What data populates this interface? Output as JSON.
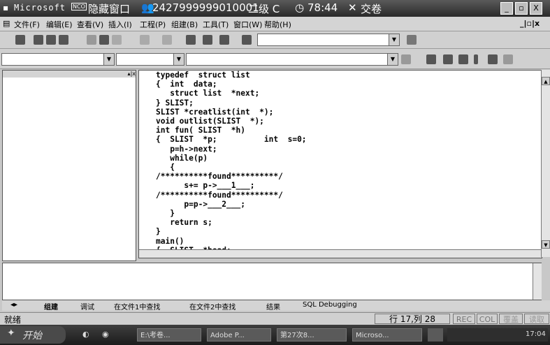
{
  "titlebar": {
    "app_name": "Microsoft",
    "badge": "NCO",
    "hide_window": "隐藏窗口",
    "exam_id": "2427999999010001",
    "level": "二级 C",
    "timer": "78:44",
    "submit": "交卷"
  },
  "window_buttons": {
    "minimize": "_",
    "restore": "▫",
    "close": "X"
  },
  "menu": {
    "items": [
      "文件(F)",
      "编辑(E)",
      "查看(V)",
      "插入(I)",
      "工程(P)",
      "组建(B)",
      "工具(T)",
      "窗口(W)",
      "帮助(H)"
    ],
    "child_controls": "_|▫|x"
  },
  "left_pane": {
    "header_controls": "▴|x"
  },
  "code_lines": [
    "typedef  struct list",
    "{  int  data;",
    "   struct list  *next;",
    "} SLIST;",
    "SLIST *creatlist(int  *);",
    "void outlist(SLIST  *);",
    "int fun( SLIST  *h)",
    "{  SLIST  *p;          int  s=0;",
    "   p=h->next;",
    "   while(p)",
    "   {",
    "/**********found**********/",
    "      s+= p->___1___;",
    "/**********found**********/",
    "      p=p->___2___;",
    "   }",
    "   return s;",
    "}",
    "main()",
    "{  SLIST  *head;"
  ],
  "output_tabs": [
    "组建",
    "调试",
    "在文件1中查找",
    "在文件2中查找",
    "结果",
    "SQL Debugging"
  ],
  "status": {
    "text": "就绪",
    "position": "行 17,列 28",
    "rec": "REC",
    "col": "COL",
    "ovr": "覆盖",
    "read": "读取"
  },
  "taskbar": {
    "start": "开始",
    "tasks": [
      "E:\\考卷...",
      "Adobe P...",
      "第27次8...",
      "Microso..."
    ],
    "clock": "17:04"
  }
}
